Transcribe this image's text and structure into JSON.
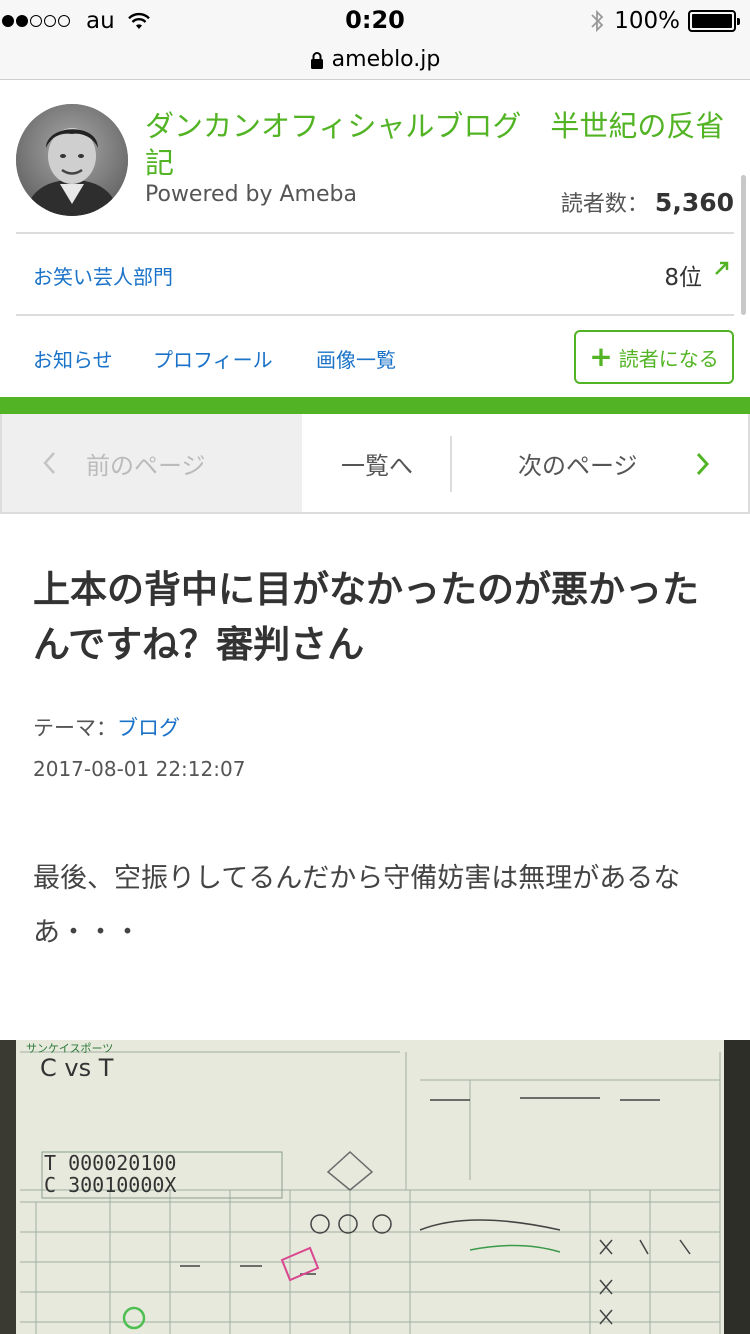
{
  "status_bar": {
    "carrier": "au",
    "time": "0:20",
    "battery": "100%"
  },
  "address_bar": {
    "url": "ameblo.jp"
  },
  "blog": {
    "title": "ダンカンオフィシャルブログ　半世紀の反省記",
    "powered": "Powered by Ameba",
    "readers_label": "読者数：",
    "readers_count": "5,360"
  },
  "ranking": {
    "category": "お笑い芸人部門",
    "position": "8位"
  },
  "nav": {
    "news": "お知らせ",
    "profile": "プロフィール",
    "images": "画像一覧",
    "follow": "読者になる"
  },
  "pager": {
    "prev": "前のページ",
    "list": "一覧へ",
    "next": "次のページ"
  },
  "article": {
    "title": "上本の背中に目がなかったのが悪かったんですね？審判さん",
    "theme_label": "テーマ：",
    "theme": "ブログ",
    "date": "2017-08-01 22:12:07",
    "body": "最後、空振りしてるんだから守備妨害は無理があるなあ・・・"
  },
  "scorecard": {
    "brand": "サンケイスポーツ",
    "line1": "T 000020100",
    "line2": "C 30010000X",
    "vs": "C vs T"
  },
  "colors": {
    "accent_green": "#52b424",
    "link_blue": "#1a73c8"
  },
  "icons": [
    "wifi-icon",
    "bluetooth-icon",
    "lock-icon",
    "trend-up-icon",
    "plus-icon",
    "chevron-left-icon",
    "chevron-right-icon"
  ]
}
